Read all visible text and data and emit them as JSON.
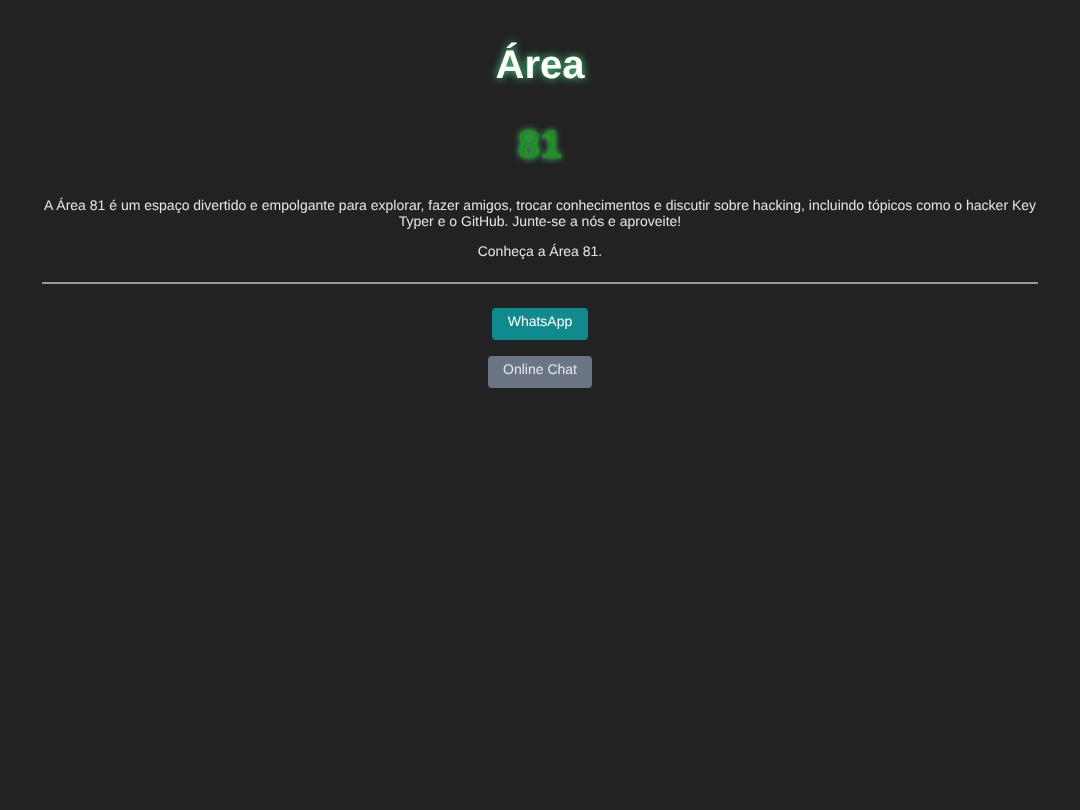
{
  "title": "Área",
  "subtitle": "81",
  "description": "A Área 81 é um espaço divertido e empolgante para explorar, fazer amigos, trocar conhecimentos e discutir sobre hacking, incluindo tópicos como o hacker Key Typer e o GitHub. Junte-se a nós e aproveite!",
  "tagline": "Conheça a Área 81.",
  "buttons": [
    {
      "label": "WhatsApp",
      "kind": "primary"
    },
    {
      "label": "Online Chat",
      "kind": "secondary"
    }
  ]
}
